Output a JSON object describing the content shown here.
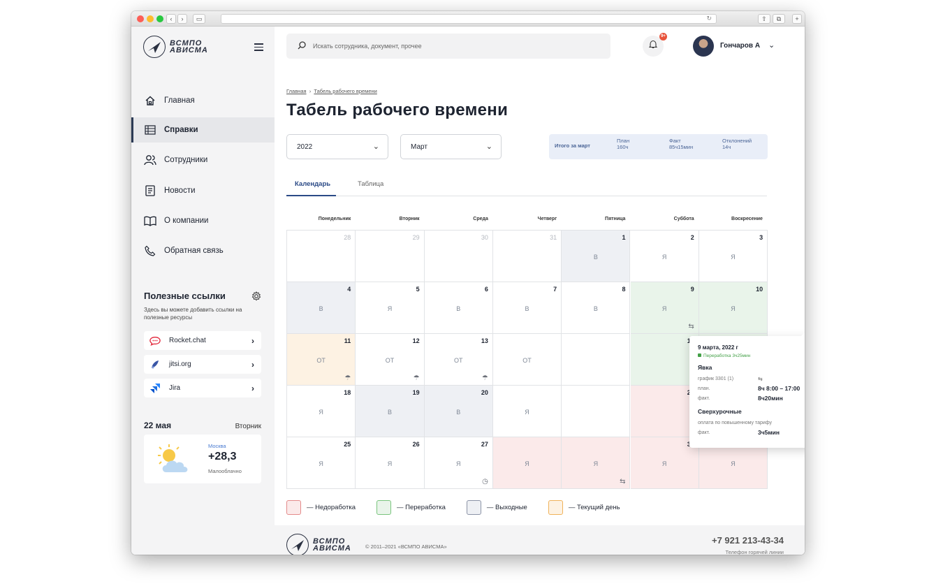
{
  "brand": {
    "line1": "ВСМПО",
    "line2": "АВИСМА"
  },
  "nav": [
    {
      "label": "Главная",
      "icon": "home-icon"
    },
    {
      "label": "Справки",
      "icon": "table-icon"
    },
    {
      "label": "Сотрудники",
      "icon": "users-icon"
    },
    {
      "label": "Новости",
      "icon": "news-icon"
    },
    {
      "label": "О компании",
      "icon": "book-icon"
    },
    {
      "label": "Обратная связь",
      "icon": "phone-icon"
    }
  ],
  "useful": {
    "title": "Полезные ссылки",
    "desc": "Здесь вы можете добавить ссылки на полезные ресурсы",
    "links": [
      {
        "label": "Rocket.chat",
        "color": "#e2263a"
      },
      {
        "label": "jitsi.org",
        "color": "#3a56a6"
      },
      {
        "label": "Jira",
        "color": "#2684ff"
      }
    ]
  },
  "weather": {
    "date": "22 мая",
    "weekday": "Вторник",
    "city": "Москва",
    "temp": "+28,3",
    "desc": "Малооблачно"
  },
  "search": {
    "placeholder": "Искать сотрудника, документ, прочее"
  },
  "notifications": {
    "badge": "9+"
  },
  "user": {
    "name": "Гончаров А"
  },
  "breadcrumb": {
    "home": "Главная",
    "sep": "›",
    "current": "Табель рабочего времени"
  },
  "page_title": "Табель рабочего времени",
  "filters": {
    "year": "2022",
    "month": "Март"
  },
  "summary": {
    "label": "Итого за март",
    "plan_label": "План",
    "plan_value": "160ч",
    "fact_label": "Факт",
    "fact_value": "85ч15мин",
    "dev_label": "Отклонений",
    "dev_value": "14ч"
  },
  "tabs": [
    {
      "label": "Календарь"
    },
    {
      "label": "Таблица"
    }
  ],
  "weekdays": [
    "Понедельник",
    "Вторник",
    "Среда",
    "Четверг",
    "Пятница",
    "Суббота",
    "Воскресение"
  ],
  "days": [
    {
      "num": "28",
      "muted": true,
      "code": "",
      "bg": "",
      "mark": ""
    },
    {
      "num": "29",
      "muted": true,
      "code": "",
      "bg": "",
      "mark": ""
    },
    {
      "num": "30",
      "muted": true,
      "code": "",
      "bg": "",
      "mark": ""
    },
    {
      "num": "31",
      "muted": true,
      "code": "",
      "bg": "",
      "mark": ""
    },
    {
      "num": "1",
      "code": "В",
      "bg": "weekend",
      "mark": ""
    },
    {
      "num": "2",
      "code": "Я",
      "bg": "",
      "mark": ""
    },
    {
      "num": "3",
      "code": "Я",
      "bg": "",
      "mark": ""
    },
    {
      "num": "4",
      "code": "В",
      "bg": "weekend",
      "mark": ""
    },
    {
      "num": "5",
      "code": "Я",
      "bg": "",
      "mark": ""
    },
    {
      "num": "6",
      "code": "В",
      "bg": "",
      "mark": ""
    },
    {
      "num": "7",
      "code": "В",
      "bg": "",
      "mark": ""
    },
    {
      "num": "8",
      "code": "В",
      "bg": "",
      "mark": ""
    },
    {
      "num": "9",
      "code": "Я",
      "bg": "over",
      "mark": "⇆"
    },
    {
      "num": "10",
      "code": "Я",
      "bg": "over",
      "mark": ""
    },
    {
      "num": "11",
      "code": "ОТ",
      "bg": "today",
      "mark": "☂"
    },
    {
      "num": "12",
      "code": "ОТ",
      "bg": "",
      "mark": "☂"
    },
    {
      "num": "13",
      "code": "ОТ",
      "bg": "",
      "mark": "☂"
    },
    {
      "num": "",
      "code": "ОТ",
      "bg": "",
      "mark": ""
    },
    {
      "num": "",
      "code": "",
      "bg": "",
      "mark": ""
    },
    {
      "num": "16",
      "code": "",
      "bg": "over",
      "mark": ""
    },
    {
      "num": "17",
      "code": "Я",
      "bg": "over",
      "mark": ""
    },
    {
      "num": "18",
      "code": "Я",
      "bg": "",
      "mark": ""
    },
    {
      "num": "19",
      "code": "В",
      "bg": "weekend",
      "mark": ""
    },
    {
      "num": "20",
      "code": "В",
      "bg": "weekend",
      "mark": ""
    },
    {
      "num": "",
      "code": "Я",
      "bg": "",
      "mark": ""
    },
    {
      "num": "",
      "code": "",
      "bg": "",
      "mark": ""
    },
    {
      "num": "23",
      "code": "",
      "bg": "under",
      "mark": ""
    },
    {
      "num": "24",
      "code": "Я",
      "bg": "under",
      "mark": ""
    },
    {
      "num": "25",
      "code": "Я",
      "bg": "",
      "mark": ""
    },
    {
      "num": "26",
      "code": "Я",
      "bg": "",
      "mark": ""
    },
    {
      "num": "27",
      "code": "Я",
      "bg": "",
      "mark": "◷"
    },
    {
      "num": "",
      "code": "Я",
      "bg": "under",
      "mark": ""
    },
    {
      "num": "",
      "code": "Я",
      "bg": "under",
      "mark": "⇆"
    },
    {
      "num": "30",
      "code": "Я",
      "bg": "under",
      "mark": ""
    },
    {
      "num": "31",
      "code": "Я",
      "bg": "under",
      "mark": ""
    }
  ],
  "tooltip": {
    "date": "9 марта, 2022 г",
    "status": "Переработка 3ч25мин",
    "section1": "Явка",
    "schedule_label": "график 3301 (1)",
    "plan_label": "план.",
    "plan_value": "8ч  8:00 – 17:00",
    "fact_label": "факт.",
    "fact_value": "8ч20мин",
    "section2": "Сверхурочные",
    "tariff": "оплата по повышенному тарифу",
    "fact2_label": "факт.",
    "fact2_value": "3ч5мин"
  },
  "legend": [
    {
      "label": "— Недоработка",
      "color": "#fbeaea",
      "border": "#e48a8a"
    },
    {
      "label": "— Переработка",
      "color": "#e9f4ea",
      "border": "#79c47d"
    },
    {
      "label": "— Выходные",
      "color": "#eef0f4",
      "border": "#8b93a6"
    },
    {
      "label": "— Текущий день",
      "color": "#fdf2e3",
      "border": "#f0b25a"
    }
  ],
  "footer": {
    "copyright": "© 2011–2021 «ВСМПО АВИСМА»",
    "phone": "+7 921 213-43-34",
    "phone_label": "Телефон горячей линии"
  }
}
